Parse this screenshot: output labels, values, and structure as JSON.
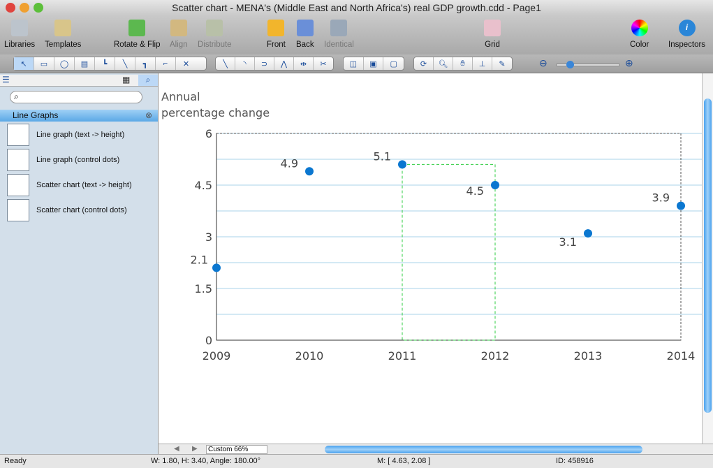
{
  "window": {
    "title": "Scatter chart - MENA's (Middle East and North Africa's) real GDP growth.cdd - Page1"
  },
  "toolbar": {
    "libraries": "Libraries",
    "templates": "Templates",
    "rotate_flip": "Rotate & Flip",
    "align": "Align",
    "distribute": "Distribute",
    "front": "Front",
    "back": "Back",
    "identical": "Identical",
    "grid": "Grid",
    "color": "Color",
    "inspectors": "Inspectors"
  },
  "sidebar": {
    "header": "Line Graphs",
    "search_placeholder": "",
    "items": [
      {
        "label": "Line graph (text -> height)"
      },
      {
        "label": "Line graph (control dots)"
      },
      {
        "label": "Scatter chart (text -> height)"
      },
      {
        "label": "Scatter chart (control dots)"
      }
    ]
  },
  "chart_data": {
    "type": "scatter",
    "ylabel_line1": "Annual",
    "ylabel_line2": "percentage change",
    "categories": [
      "2009",
      "2010",
      "2011",
      "2012",
      "2013",
      "2014"
    ],
    "values": [
      2.1,
      4.9,
      5.1,
      4.5,
      3.1,
      3.9
    ],
    "labels": [
      "2.1",
      "4.9",
      "5.1",
      "4.5",
      "3.1",
      "3.9"
    ],
    "yticks": [
      "0",
      "1.5",
      "3",
      "4.5",
      "6"
    ],
    "ylim": [
      0,
      6
    ],
    "grid": true,
    "point_color": "#0b77d0",
    "grid_color": "#a9d3ea"
  },
  "zoom": {
    "value": "Custom 66%"
  },
  "status": {
    "ready": "Ready",
    "dims": "W: 1.80,  H: 3.40,  Angle: 180.00°",
    "mouse": "M: [ 4.63, 2.08 ]",
    "id": "ID: 458916"
  }
}
